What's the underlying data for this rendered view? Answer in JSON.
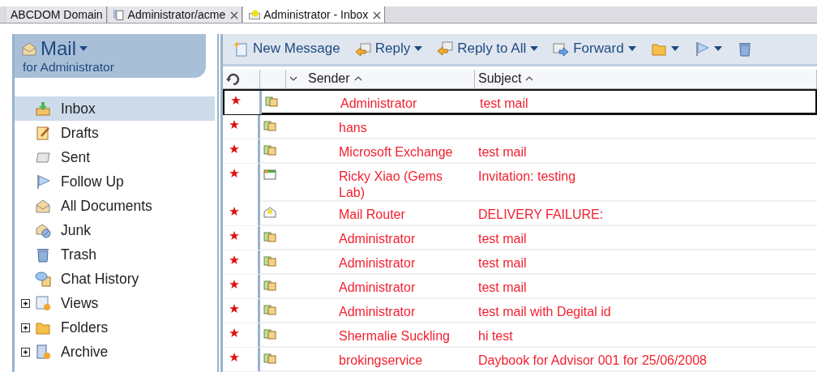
{
  "tabs": [
    {
      "label": "ABCDOM Domain",
      "kind": "plain",
      "closable": false,
      "selected": false
    },
    {
      "label": "Administrator/acme",
      "kind": "directory",
      "closable": true,
      "selected": false
    },
    {
      "label": "Administrator - Inbox",
      "kind": "mail",
      "closable": true,
      "selected": true
    }
  ],
  "sidebar": {
    "title": "Mail",
    "subtitle": "for Administrator",
    "items": [
      {
        "label": "Inbox",
        "kind": "inbox",
        "expandable": false,
        "selected": true
      },
      {
        "label": "Drafts",
        "kind": "drafts",
        "expandable": false,
        "selected": false
      },
      {
        "label": "Sent",
        "kind": "sent",
        "expandable": false,
        "selected": false
      },
      {
        "label": "Follow Up",
        "kind": "flag",
        "expandable": false,
        "selected": false
      },
      {
        "label": "All Documents",
        "kind": "envelope",
        "expandable": false,
        "selected": false
      },
      {
        "label": "Junk",
        "kind": "junk",
        "expandable": false,
        "selected": false
      },
      {
        "label": "Trash",
        "kind": "trash",
        "expandable": false,
        "selected": false
      },
      {
        "label": "Chat History",
        "kind": "chat",
        "expandable": false,
        "selected": false
      },
      {
        "label": "Views",
        "kind": "views",
        "expandable": true,
        "selected": false
      },
      {
        "label": "Folders",
        "kind": "folder",
        "expandable": true,
        "selected": false
      },
      {
        "label": "Archive",
        "kind": "archive",
        "expandable": true,
        "selected": false
      }
    ]
  },
  "toolbar": [
    {
      "label": "New Message",
      "kind": "new",
      "dropdown": false
    },
    {
      "label": "Reply",
      "kind": "reply",
      "dropdown": true
    },
    {
      "label": "Reply to All",
      "kind": "replyall",
      "dropdown": true
    },
    {
      "label": "Forward",
      "kind": "forward",
      "dropdown": true
    },
    {
      "kind": "folder",
      "dropdown": true
    },
    {
      "kind": "flag",
      "dropdown": true
    },
    {
      "kind": "trash",
      "dropdown": false
    }
  ],
  "table": {
    "columns": [
      "Sender",
      "Subject"
    ],
    "rows": [
      {
        "kind": "message",
        "starred": true,
        "selected": true,
        "sender": "Administrator",
        "subject": "test mail"
      },
      {
        "kind": "message",
        "starred": true,
        "selected": false,
        "sender": "hans"
      },
      {
        "kind": "message",
        "starred": true,
        "selected": false,
        "sender": "Microsoft Exchange",
        "subject": "test mail"
      },
      {
        "kind": "invitation",
        "starred": true,
        "selected": false,
        "sender": "Ricky Xiao (Gems Lab)",
        "subject": "Invitation: testing"
      },
      {
        "kind": "notice",
        "starred": true,
        "selected": false,
        "sender": "Mail Router",
        "subject": "DELIVERY FAILURE:"
      },
      {
        "kind": "message",
        "starred": true,
        "selected": false,
        "sender": "Administrator",
        "subject": "test mail"
      },
      {
        "kind": "message",
        "starred": true,
        "selected": false,
        "sender": "Administrator",
        "subject": "test mail"
      },
      {
        "kind": "message",
        "starred": true,
        "selected": false,
        "sender": "Administrator",
        "subject": "test mail"
      },
      {
        "kind": "message",
        "starred": true,
        "selected": false,
        "sender": "Administrator",
        "subject": "test mail with Degital id"
      },
      {
        "kind": "message",
        "starred": true,
        "selected": false,
        "sender": "Shermalie Suckling",
        "subject": "hi test"
      },
      {
        "kind": "message",
        "starred": true,
        "selected": false,
        "sender": "brokingservice",
        "subject": "Daybook for Advisor 001 for 25/06/2008"
      }
    ]
  }
}
